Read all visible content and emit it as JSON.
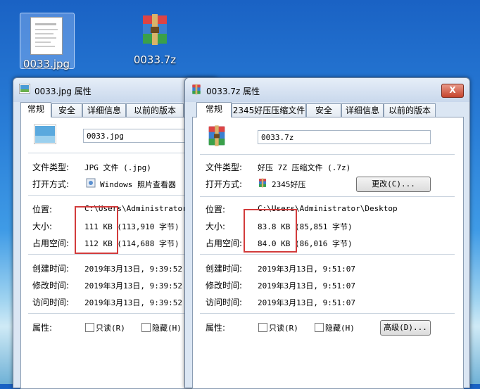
{
  "desktop": {
    "icons": [
      {
        "label": "0033.jpg"
      },
      {
        "label": "0033.7z"
      }
    ]
  },
  "left_window": {
    "title": "0033.jpg 属性",
    "tabs": [
      "常规",
      "安全",
      "详细信息",
      "以前的版本"
    ],
    "filename": "0033.jpg",
    "file_type_label": "文件类型:",
    "file_type_value": "JPG 文件 (.jpg)",
    "open_with_label": "打开方式:",
    "open_with_value": "Windows 照片查看器",
    "location_label": "位置:",
    "location_value": "C:\\Users\\Administrator\\De",
    "size_label": "大小:",
    "size_value": "111 KB (113,910 字节)",
    "disk_size_label": "占用空间:",
    "disk_size_value": "112 KB (114,688 字节)",
    "created_label": "创建时间:",
    "created_value": "2019年3月13日, 9:39:52",
    "modified_label": "修改时间:",
    "modified_value": "2019年3月13日, 9:39:52",
    "accessed_label": "访问时间:",
    "accessed_value": "2019年3月13日, 9:39:52",
    "attributes_label": "属性:",
    "readonly_label": "只读(R)",
    "hidden_label": "隐藏(H)"
  },
  "right_window": {
    "title": "0033.7z 属性",
    "close_label": "X",
    "tabs": [
      "常规",
      "2345好压压缩文件",
      "安全",
      "详细信息",
      "以前的版本"
    ],
    "filename": "0033.7z",
    "file_type_label": "文件类型:",
    "file_type_value": "好压 7Z 压缩文件 (.7z)",
    "open_with_label": "打开方式:",
    "open_with_value": "2345好压",
    "change_button": "更改(C)...",
    "location_label": "位置:",
    "location_value": "C:\\Users\\Administrator\\Desktop",
    "size_label": "大小:",
    "size_value": "83.8 KB (85,851 字节)",
    "disk_size_label": "占用空间:",
    "disk_size_value": "84.0 KB (86,016 字节)",
    "created_label": "创建时间:",
    "created_value": "2019年3月13日, 9:51:07",
    "modified_label": "修改时间:",
    "modified_value": "2019年3月13日, 9:51:07",
    "accessed_label": "访问时间:",
    "accessed_value": "2019年3月13日, 9:51:07",
    "attributes_label": "属性:",
    "readonly_label": "只读(R)",
    "hidden_label": "隐藏(H)",
    "advanced_button": "高级(D)..."
  },
  "colors": {
    "highlight_box": "#d23b3b",
    "desktop_blue": "#2a7fd8"
  }
}
